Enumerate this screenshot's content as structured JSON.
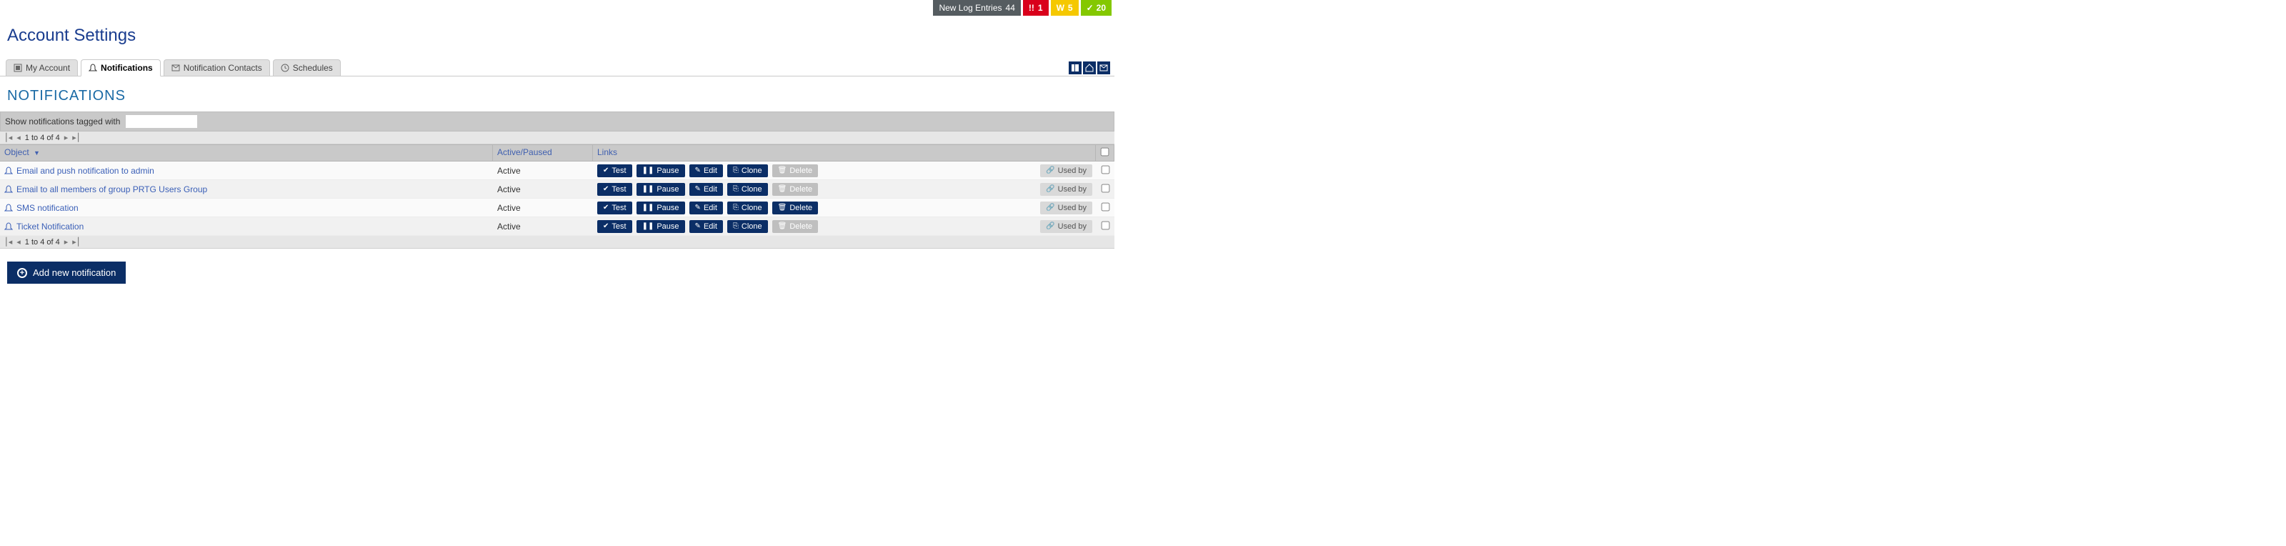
{
  "status_bar": {
    "log_label": "New Log Entries",
    "log_count": "44",
    "err_label": "!!",
    "err_count": "1",
    "warn_label": "W",
    "warn_count": "5",
    "ok_count": "20"
  },
  "page_title": "Account Settings",
  "tabs": [
    {
      "label": "My Account"
    },
    {
      "label": "Notifications"
    },
    {
      "label": "Notification Contacts"
    },
    {
      "label": "Schedules"
    }
  ],
  "section_title": "NOTIFICATIONS",
  "filter": {
    "label": "Show notifications tagged with",
    "value": ""
  },
  "pager": {
    "text": "1 to 4 of 4"
  },
  "columns": {
    "object": "Object",
    "state": "Active/Paused",
    "links": "Links"
  },
  "buttons": {
    "test": "Test",
    "pause": "Pause",
    "edit": "Edit",
    "clone": "Clone",
    "delete": "Delete",
    "used_by": "Used by",
    "add": "Add new notification"
  },
  "rows": [
    {
      "name": "Email and push notification to admin",
      "state": "Active",
      "delete_enabled": false
    },
    {
      "name": "Email to all members of group PRTG Users Group",
      "state": "Active",
      "delete_enabled": false
    },
    {
      "name": "SMS notification",
      "state": "Active",
      "delete_enabled": true
    },
    {
      "name": "Ticket Notification",
      "state": "Active",
      "delete_enabled": false
    }
  ]
}
